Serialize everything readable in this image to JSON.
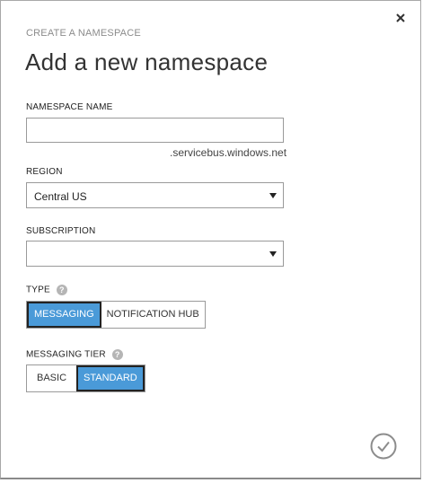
{
  "dialog": {
    "overline": "CREATE A NAMESPACE",
    "title": "Add a new namespace"
  },
  "namespace": {
    "label": "NAMESPACE NAME",
    "value": "",
    "suffix": ".servicebus.windows.net"
  },
  "region": {
    "label": "REGION",
    "selected": "Central US"
  },
  "subscription": {
    "label": "SUBSCRIPTION",
    "selected": ""
  },
  "type": {
    "label": "TYPE",
    "options": [
      "MESSAGING",
      "NOTIFICATION HUB"
    ],
    "selected": "MESSAGING"
  },
  "tier": {
    "label": "MESSAGING TIER",
    "options": [
      "BASIC",
      "STANDARD"
    ],
    "selected": "STANDARD"
  },
  "colors": {
    "accent": "#4a9ad8",
    "help_icon": "#b5b5b5"
  },
  "icons": {
    "close": "close-icon",
    "help": "question-mark-icon",
    "confirm": "checkmark-circle-icon",
    "dropdown": "chevron-down-icon"
  }
}
